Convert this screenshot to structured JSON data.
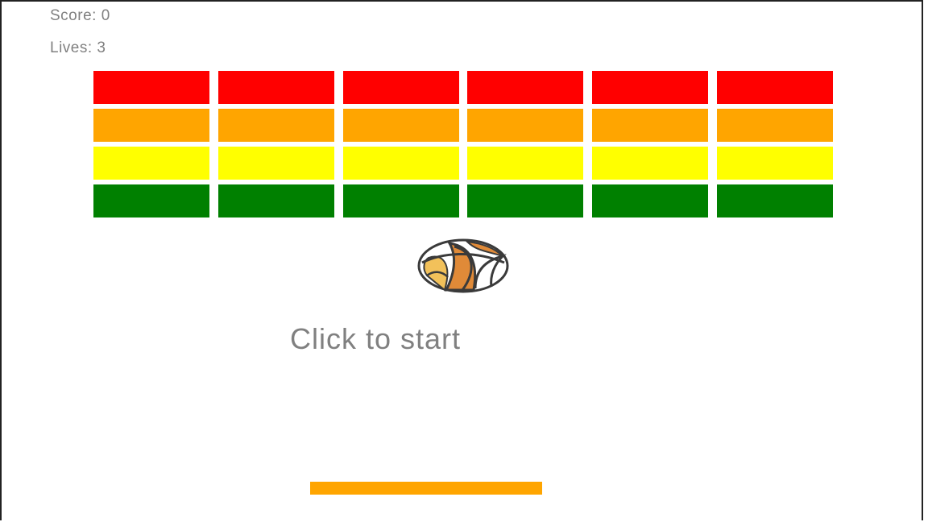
{
  "hud": {
    "score_label": "Score: 0",
    "lives_label": "Lives: 3",
    "score": 0,
    "lives": 3
  },
  "message": "Click to start",
  "bricks": {
    "columns": 6,
    "row_colors": [
      "#ff0000",
      "#ffa500",
      "#ffff00",
      "#008000"
    ]
  },
  "ball": {
    "icon": "basketball-icon"
  },
  "paddle": {
    "color": "#ffa500"
  }
}
